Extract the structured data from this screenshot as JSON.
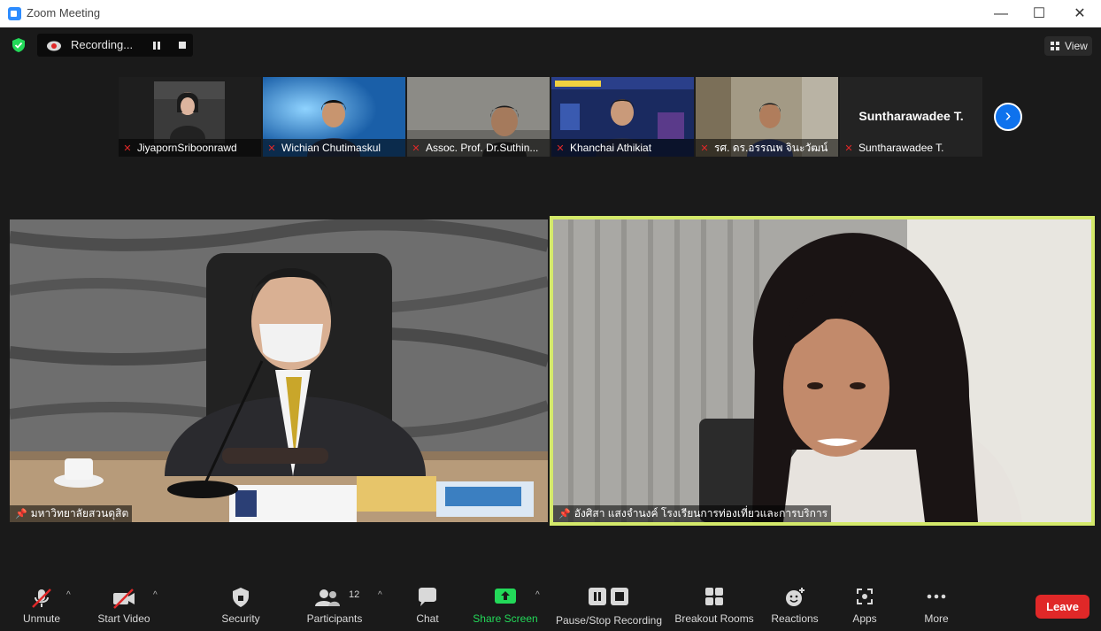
{
  "window": {
    "title": "Zoom Meeting",
    "minimize": "—",
    "maximize": "☐",
    "close": "✕"
  },
  "recording": {
    "label": "Recording..."
  },
  "view": {
    "label": "View"
  },
  "thumbnails": [
    {
      "name": "JiyapornSriboonrawd"
    },
    {
      "name": "Wichian Chutimaskul"
    },
    {
      "name": "Assoc. Prof. Dr.Suthin..."
    },
    {
      "name": "Khanchai Athikiat"
    },
    {
      "name": "รศ. ดร.อรรณพ จินะวัฒน์"
    },
    {
      "name": "Suntharawadee T.",
      "display_name": "Suntharawadee T."
    }
  ],
  "main_videos": [
    {
      "label": "มหาวิทยาลัยสวนดุสิต"
    },
    {
      "label": "อังศิสา แสงจำนงค์ โรงเรียนการท่องเที่ยวและการบริการ"
    }
  ],
  "toolbar": {
    "unmute": "Unmute",
    "start_video": "Start Video",
    "security": "Security",
    "participants": "Participants",
    "participants_count": "12",
    "chat": "Chat",
    "share_screen": "Share Screen",
    "pause_stop_recording": "Pause/Stop Recording",
    "breakout_rooms": "Breakout Rooms",
    "reactions": "Reactions",
    "apps": "Apps",
    "more": "More",
    "leave": "Leave"
  },
  "colors": {
    "accent": "#0e72ed",
    "share_green": "#23d959",
    "leave_red": "#e02828",
    "active_border": "#d4e96a"
  }
}
